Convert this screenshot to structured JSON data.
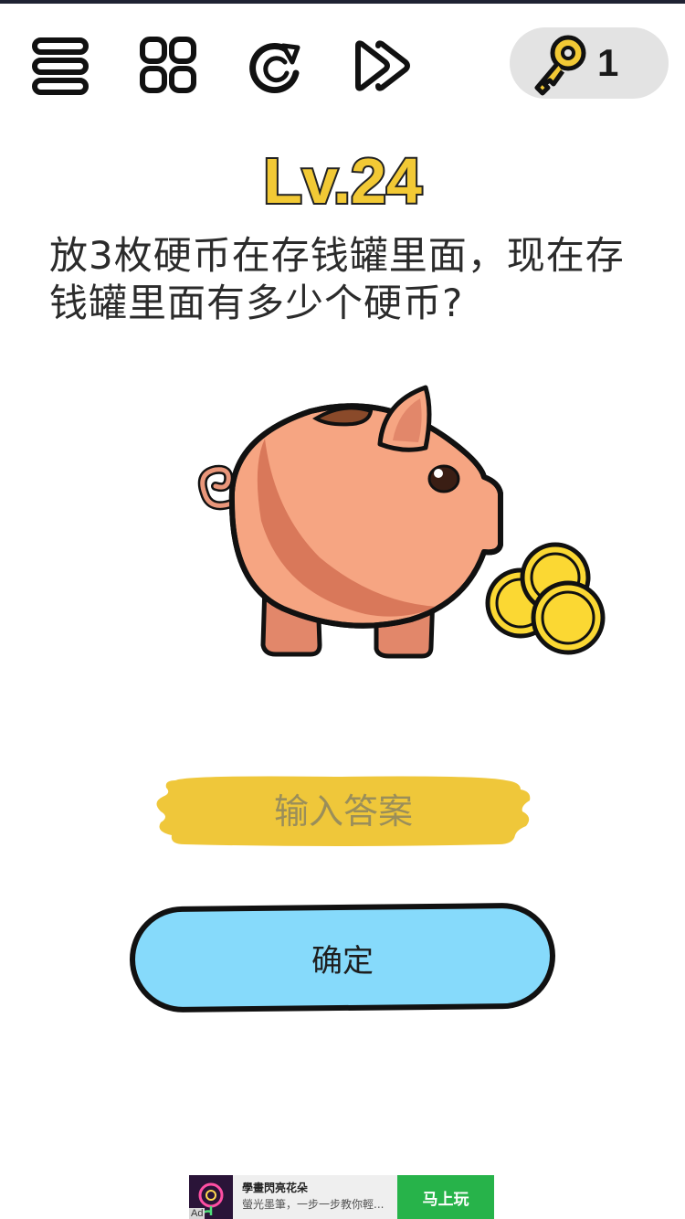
{
  "level": {
    "label": "Lv.24"
  },
  "key": {
    "count": "1"
  },
  "toolbar": {
    "icons": [
      "menu-icon",
      "levels-grid-icon",
      "restart-icon",
      "skip-icon"
    ]
  },
  "question": {
    "text": "放3枚硬币在存钱罐里面，现在存钱罐里面有多少个硬币?"
  },
  "answer": {
    "placeholder": "输入答案",
    "value": ""
  },
  "confirm": {
    "label": "确定"
  },
  "ad": {
    "badge": "Ad",
    "title": "學畫閃亮花朵",
    "description": "螢光墨筆，一步一步教你輕...",
    "cta": "马上玩"
  },
  "colors": {
    "level_yellow": "#f2c935",
    "answer_yellow": "#efc73a",
    "confirm_blue": "#86dafb",
    "pig": "#f6a582",
    "coin": "#fbd833",
    "ad_green": "#27b34a"
  }
}
